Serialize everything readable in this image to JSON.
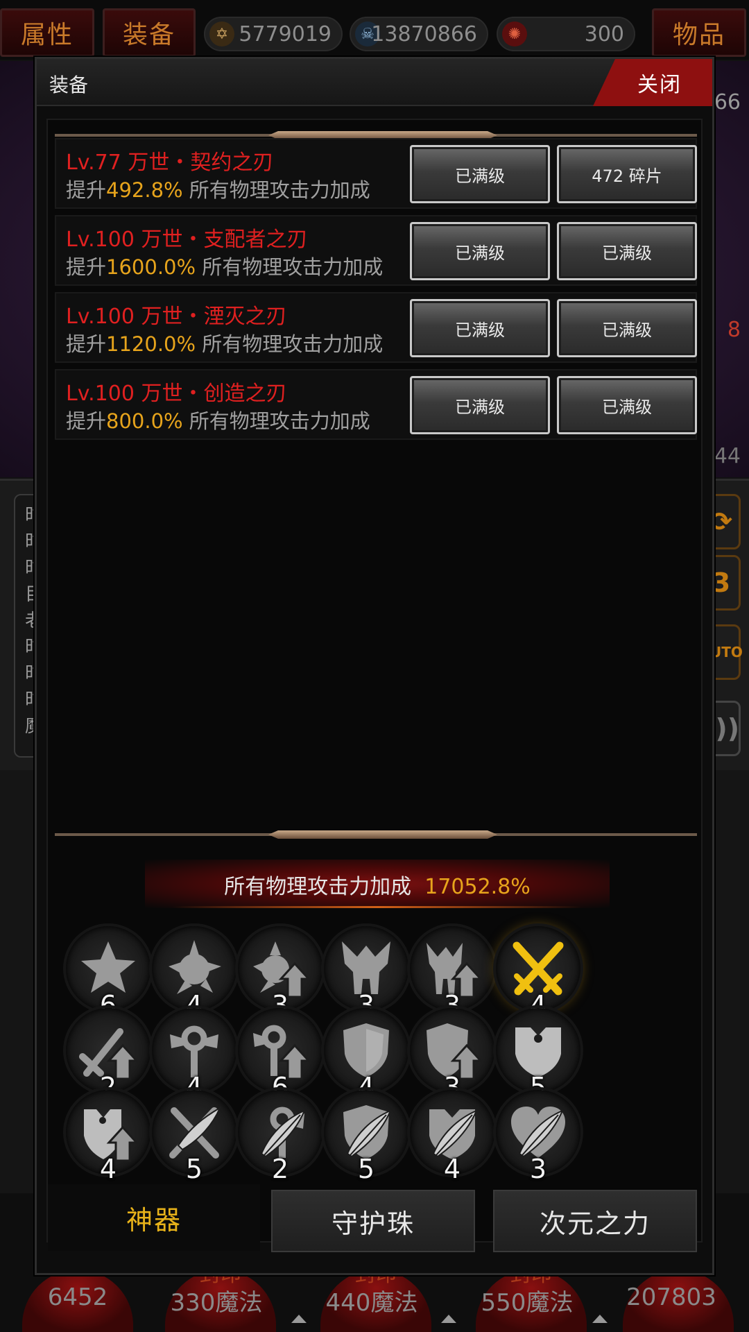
{
  "top_bar": {
    "tab_attributes": "属性",
    "tab_equipment": "装备",
    "tab_items": "物品",
    "currencies": [
      {
        "icon": "gold-emblem-icon",
        "value": "5779019"
      },
      {
        "icon": "skull-icon",
        "value": "13870866"
      },
      {
        "icon": "red-orb-icon",
        "value": "300"
      }
    ]
  },
  "modal": {
    "title": "装备",
    "close_label": "关闭",
    "rows": [
      {
        "title": "Lv.77 万世・契约之刃",
        "desc_prefix": "提升",
        "desc_value": "492.8%",
        "desc_suffix": " 所有物理攻击力加成",
        "button_1": "已满级",
        "button_2": "472 碎片"
      },
      {
        "title": "Lv.100 万世・支配者之刃",
        "desc_prefix": "提升",
        "desc_value": "1600.0%",
        "desc_suffix": " 所有物理攻击力加成",
        "button_1": "已满级",
        "button_2": "已满级"
      },
      {
        "title": "Lv.100 万世・湮灭之刃",
        "desc_prefix": "提升",
        "desc_value": "1120.0%",
        "desc_suffix": " 所有物理攻击力加成",
        "button_1": "已满级",
        "button_2": "已满级"
      },
      {
        "title": "Lv.100 万世・创造之刃",
        "desc_prefix": "提升",
        "desc_value": "800.0%",
        "desc_suffix": " 所有物理攻击力加成",
        "button_1": "已满级",
        "button_2": "已满级"
      }
    ],
    "total_bonus_label": "所有物理攻击力加成",
    "total_bonus_value": "17052.8%",
    "artifacts": [
      {
        "icon": "star-icon",
        "count": "6"
      },
      {
        "icon": "spiked-orb-icon",
        "count": "4"
      },
      {
        "icon": "spiked-orb-upgrade-icon",
        "count": "3"
      },
      {
        "icon": "winged-helm-icon",
        "count": "3"
      },
      {
        "icon": "winged-helm-upgrade-icon",
        "count": "3"
      },
      {
        "icon": "crossed-swords-icon",
        "count": "4",
        "active": true
      },
      {
        "icon": "sword-upgrade-icon",
        "count": "2"
      },
      {
        "icon": "scepter-icon",
        "count": "4"
      },
      {
        "icon": "scepter-upgrade-icon",
        "count": "6"
      },
      {
        "icon": "shield-icon",
        "count": "4"
      },
      {
        "icon": "shield-upgrade-icon",
        "count": "3"
      },
      {
        "icon": "pendant-shield-icon",
        "count": "5"
      },
      {
        "icon": "pendant-shield-upgrade-icon",
        "count": "4"
      },
      {
        "icon": "crossed-blades-icon",
        "count": "5"
      },
      {
        "icon": "scepter-feather-icon",
        "count": "2"
      },
      {
        "icon": "shield-feather-icon",
        "count": "5"
      },
      {
        "icon": "pendant-feather-icon",
        "count": "4"
      },
      {
        "icon": "heart-feather-icon",
        "count": "3"
      }
    ],
    "tabs": {
      "artifact": "神器",
      "guardian_orb": "守护珠",
      "dimension_power": "次元之力"
    }
  },
  "background": {
    "right_numbers": [
      "66",
      "8",
      "44"
    ],
    "bottom_values": [
      "6452",
      "330魔法",
      "440魔法",
      "550魔法",
      "207803"
    ],
    "bottom_orb_labels": [
      "封印",
      "封印",
      "封印"
    ],
    "log_chars": [
      "时",
      "时",
      "时",
      "目",
      "老",
      "时",
      "时",
      "时",
      "魔"
    ]
  },
  "colors": {
    "accent_red": "#8e1010",
    "title_red": "#e02020",
    "highlight_gold": "#e7a41c",
    "active_tab": "#e7b21a"
  }
}
